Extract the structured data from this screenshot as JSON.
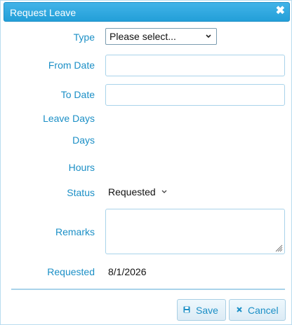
{
  "dialog": {
    "title": "Request Leave",
    "close_glyph": "✖"
  },
  "form": {
    "type_label": "Type",
    "type_value": "Please select...",
    "from_date_label": "From Date",
    "from_date_value": "",
    "to_date_label": "To Date",
    "to_date_value": "",
    "leave_days_label": "Leave Days",
    "days_label": "Days",
    "days_value": "",
    "hours_label": "Hours",
    "hours_value": "",
    "status_label": "Status",
    "status_value": "Requested",
    "remarks_label": "Remarks",
    "remarks_value": "",
    "requested_label": "Requested",
    "requested_value": "8/1/2026"
  },
  "buttons": {
    "save_label": "Save",
    "save_icon": "floppy-disk-icon",
    "cancel_label": "Cancel",
    "cancel_icon": "close-x-icon"
  },
  "colors": {
    "title_bar": "#2aa7df",
    "label_text": "#1b8fc6",
    "input_border": "#a9d3ea"
  }
}
